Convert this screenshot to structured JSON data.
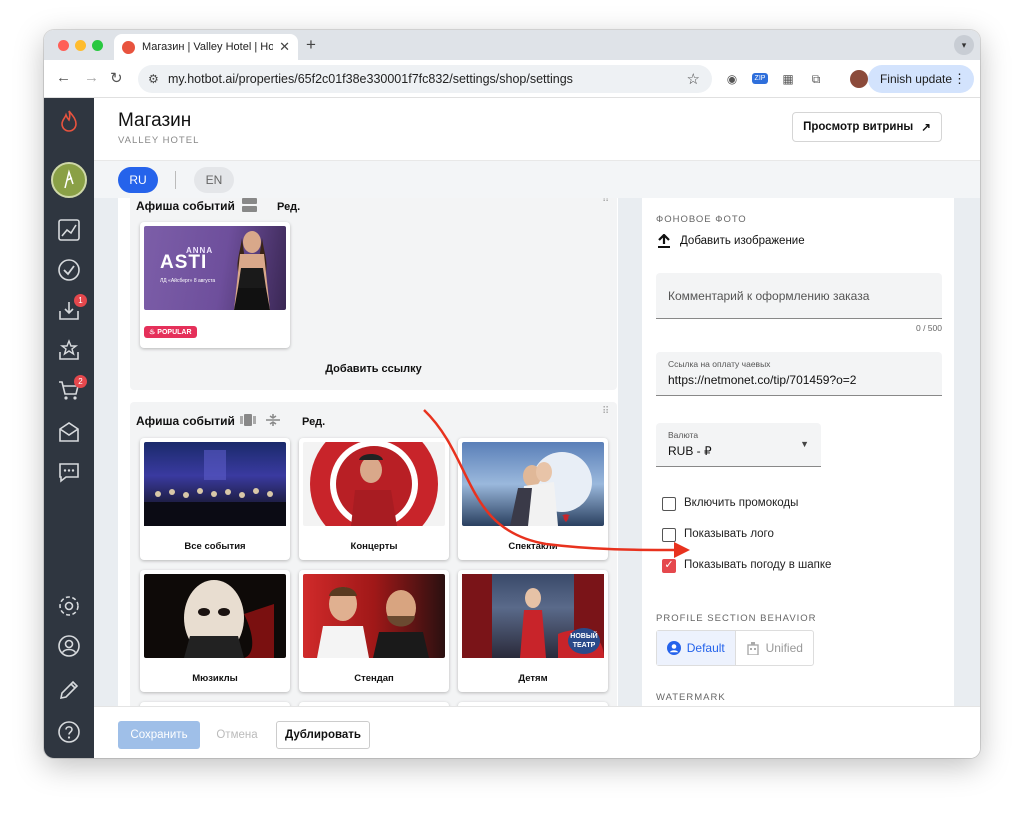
{
  "browser": {
    "tab_title": "Магазин | Valley Hotel | Hotbot",
    "tab_close": "✕",
    "new_tab": "+",
    "url": "my.hotbot.ai/properties/65f2c01f38e330001f7fc832/settings/shop/settings",
    "finish_update": "Finish update"
  },
  "sidebar": {
    "badges": {
      "inbox": "1",
      "cart": "2"
    }
  },
  "header": {
    "title": "Магазин",
    "subtitle": "VALLEY HOTEL",
    "storefront_button": "Просмотр витрины"
  },
  "languages": {
    "ru": "RU",
    "en": "EN"
  },
  "blocks": [
    {
      "title": "Афиша событий",
      "edit": "Ред.",
      "add_link": "Добавить ссылку",
      "cards": [
        {
          "poster_line1": "ANNA",
          "poster_line2": "ASTI",
          "poster_line3": "ЛД «Айсберг» 8 августа",
          "badge": "POPULAR"
        }
      ]
    },
    {
      "title": "Афиша событий",
      "edit": "Ред.",
      "cards": [
        {
          "caption": "Все события"
        },
        {
          "caption": "Концерты"
        },
        {
          "caption": "Спектакли"
        },
        {
          "caption": "Мюзиклы"
        },
        {
          "caption": "Стендап"
        },
        {
          "caption": "Детям",
          "badge_line1": "НОВЫЙ",
          "badge_line2": "ТЕАТР"
        }
      ]
    }
  ],
  "settings": {
    "bg_photo_label": "ФОНОВОЕ ФОТО",
    "add_image": "Добавить изображение",
    "order_comment_placeholder": "Комментарий к оформлению заказа",
    "order_comment_counter": "0 / 500",
    "tips_label": "Ссылка на оплату чаевых",
    "tips_value": "https://netmonet.co/tip/701459?o=2",
    "currency_label": "Валюта",
    "currency_value": "RUB - ₽",
    "checkboxes": [
      {
        "label": "Включить промокоды",
        "checked": false
      },
      {
        "label": "Показывать лого",
        "checked": false
      },
      {
        "label": "Показывать погоду в шапке",
        "checked": true
      }
    ],
    "profile_section_label": "PROFILE SECTION BEHAVIOR",
    "profile_options": {
      "default": "Default",
      "unified": "Unified"
    },
    "watermark_label": "WATERMARK"
  },
  "footer": {
    "save": "Сохранить",
    "cancel": "Отмена",
    "duplicate": "Дублировать"
  },
  "colors": {
    "accent_blue": "#2563eb",
    "sidebar_bg": "#2f3640",
    "checkbox_red": "#e5484d",
    "arrow_red": "#e8321e"
  }
}
